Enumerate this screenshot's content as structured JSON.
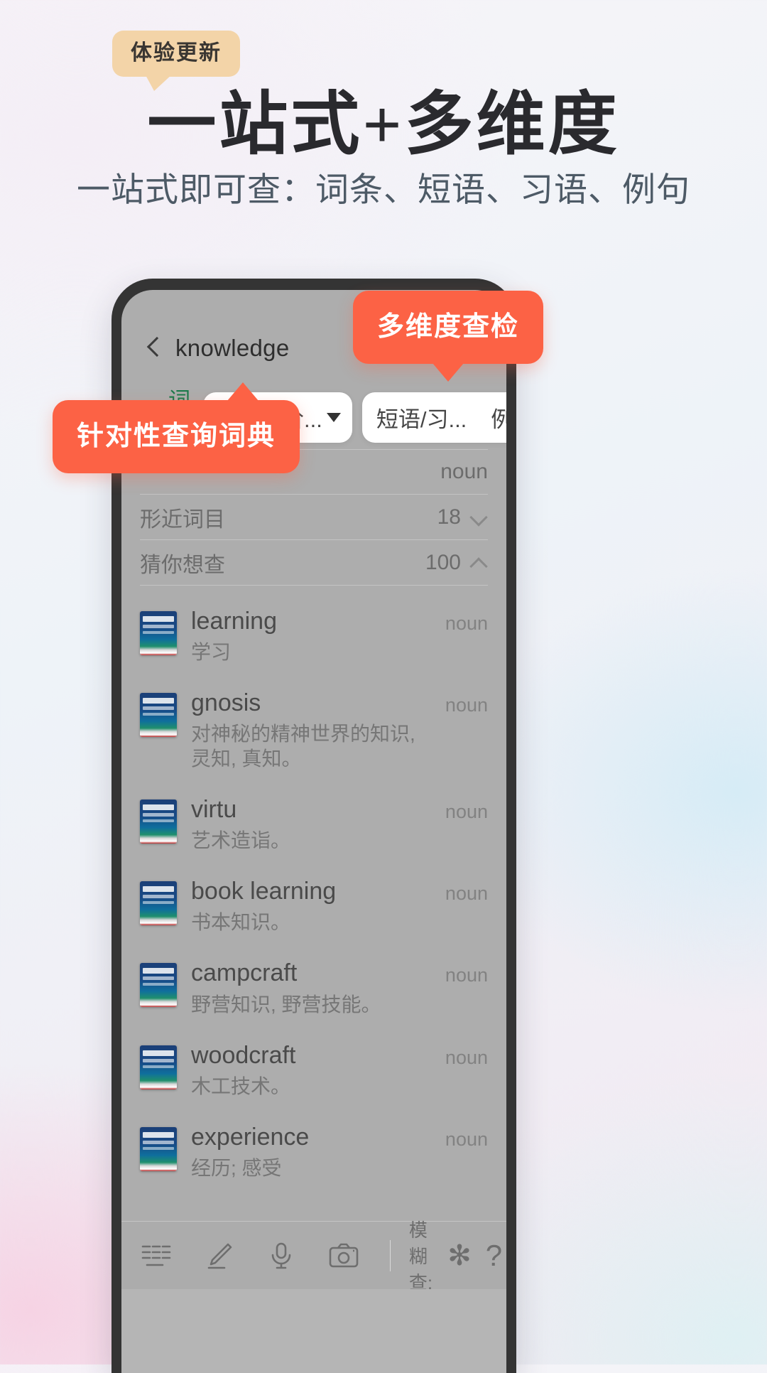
{
  "hero": {
    "badge": "体验更新",
    "headline": "一站式+多维度",
    "subline": "一站式即可查：词条、短语、习语、例句"
  },
  "callouts": {
    "multi_dimension": "多维度查检",
    "targeted_dictionary": "针对性查询词典"
  },
  "phone": {
    "navbar": {
      "back_icon": "chevron-left-icon",
      "title": "knowledge"
    },
    "tabs": {
      "entry_tab": "词目",
      "dictionary_selector": "牛津中阶...",
      "dictionary_selector_caret": "chevron-down-icon",
      "phrase_tab": "短语/习...",
      "example_tab": "例句"
    },
    "collapsible_rows": [
      {
        "label": "形近词目",
        "count": "18",
        "state": "chevron-down-icon"
      },
      {
        "label": "猜你想查",
        "count": "100",
        "state": "chevron-up-icon"
      }
    ],
    "partial_row": {
      "pos": "noun"
    },
    "words": [
      {
        "term": "learning",
        "pos": "noun",
        "definition": "学习"
      },
      {
        "term": "gnosis",
        "pos": "noun",
        "definition": "对神秘的精神世界的知识, 灵知, 真知。"
      },
      {
        "term": "virtu",
        "pos": "noun",
        "definition": "艺术造诣。"
      },
      {
        "term": "book learning",
        "pos": "noun",
        "definition": "书本知识。"
      },
      {
        "term": "campcraft",
        "pos": "noun",
        "definition": "野营知识, 野营技能。"
      },
      {
        "term": "woodcraft",
        "pos": "noun",
        "definition": "木工技术。"
      },
      {
        "term": "experience",
        "pos": "noun",
        "definition": "经历; 感受"
      }
    ],
    "toolbar": {
      "icons": [
        "list-lines-icon",
        "pencil-icon",
        "microphone-icon",
        "camera-icon"
      ],
      "fuzzy_label": "模糊查:",
      "asterisk": "✻",
      "question": "?"
    }
  },
  "colors": {
    "accent": "#fc6245",
    "badge": "#f3d4a8",
    "tab_active": "#1b7a4b",
    "phone_frame": "#343434"
  }
}
